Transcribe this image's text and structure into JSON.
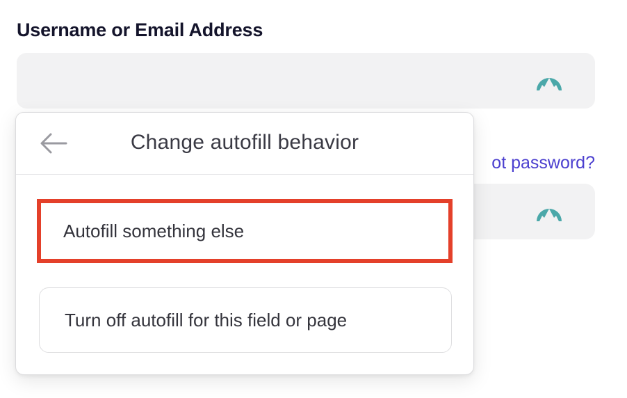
{
  "form": {
    "username_label": "Username or Email Address",
    "forgot_password_text": "ot password?",
    "icon": "nordpass-mountain-icon",
    "icon_color": "#4ba8a9",
    "link_color": "#4b3fcf"
  },
  "popup": {
    "back_icon": "arrow-left-icon",
    "title": "Change autofill behavior",
    "options": [
      {
        "label": "Autofill something else",
        "highlighted": true
      },
      {
        "label": "Turn off autofill for this field or page",
        "highlighted": false
      }
    ],
    "highlight_color": "#e4402a"
  }
}
